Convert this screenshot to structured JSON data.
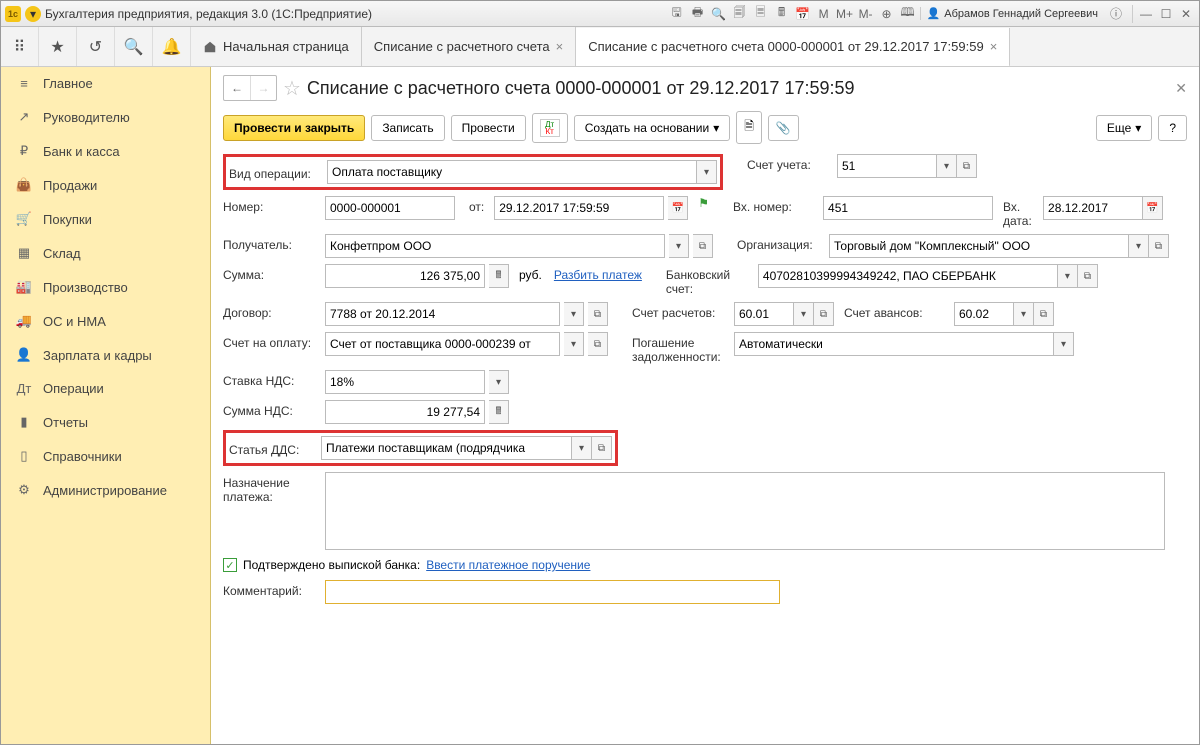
{
  "titlebar": {
    "app_title": "Бухгалтерия предприятия, редакция 3.0  (1С:Предприятие)",
    "user": "Абрамов Геннадий Сергеевич",
    "labels_M": [
      "M",
      "M+",
      "M-"
    ]
  },
  "toolbar": {
    "tabs": [
      {
        "label": "Начальная страница",
        "home": true
      },
      {
        "label": "Списание с расчетного счета",
        "closeable": true
      },
      {
        "label": "Списание с расчетного счета 0000-000001 от 29.12.2017 17:59:59",
        "closeable": true,
        "active": true
      }
    ]
  },
  "sidebar": {
    "items": [
      {
        "icon": "≡",
        "label": "Главное"
      },
      {
        "icon": "↗",
        "label": "Руководителю"
      },
      {
        "icon": "₽",
        "label": "Банк и касса"
      },
      {
        "icon": "👜",
        "label": "Продажи"
      },
      {
        "icon": "🛒",
        "label": "Покупки"
      },
      {
        "icon": "▦",
        "label": "Склад"
      },
      {
        "icon": "🏭",
        "label": "Производство"
      },
      {
        "icon": "🚚",
        "label": "ОС и НМА"
      },
      {
        "icon": "👤",
        "label": "Зарплата и кадры"
      },
      {
        "icon": "Дт",
        "label": "Операции"
      },
      {
        "icon": "▮",
        "label": "Отчеты"
      },
      {
        "icon": "▯",
        "label": "Справочники"
      },
      {
        "icon": "⚙",
        "label": "Администрирование"
      }
    ]
  },
  "doc": {
    "title": "Списание с расчетного счета 0000-000001 от 29.12.2017 17:59:59",
    "actions": {
      "post_close": "Провести и закрыть",
      "save": "Записать",
      "post": "Провести",
      "create_based": "Создать на основании",
      "more": "Еще",
      "help": "?"
    },
    "fields": {
      "op_type_lbl": "Вид операции:",
      "op_type": "Оплата поставщику",
      "acct_lbl": "Счет учета:",
      "acct": "51",
      "num_lbl": "Номер:",
      "num": "0000-000001",
      "from_lbl": "от:",
      "date": "29.12.2017 17:59:59",
      "in_num_lbl": "Вх. номер:",
      "in_num": "451",
      "in_date_lbl": "Вх. дата:",
      "in_date": "28.12.2017",
      "recipient_lbl": "Получатель:",
      "recipient": "Конфетпром ООО",
      "org_lbl": "Организация:",
      "org": "Торговый дом \"Комплексный\" ООО",
      "sum_lbl": "Сумма:",
      "sum": "126 375,00",
      "currency": "руб.",
      "split_link": "Разбить платеж",
      "bank_lbl": "Банковский счет:",
      "bank": "40702810399994349242, ПАО СБЕРБАНК",
      "contract_lbl": "Договор:",
      "contract": "7788 от 20.12.2014",
      "settle_acct_lbl": "Счет расчетов:",
      "settle_acct": "60.01",
      "advance_acct_lbl": "Счет авансов:",
      "advance_acct": "60.02",
      "pay_acct_lbl": "Счет на оплату:",
      "pay_acct": "Счет от поставщика 0000-000239 от",
      "debt_lbl": "Погашение задолженности:",
      "debt": "Автоматически",
      "vat_rate_lbl": "Ставка НДС:",
      "vat_rate": "18%",
      "vat_sum_lbl": "Сумма НДС:",
      "vat_sum": "19 277,54",
      "dds_lbl": "Статья ДДС:",
      "dds": "Платежи поставщикам (подрядчика",
      "purpose_lbl": "Назначение платежа:",
      "purpose": "",
      "confirmed_lbl": "Подтверждено выпиской банка:",
      "enter_order_link": "Ввести платежное поручение",
      "comment_lbl": "Комментарий:",
      "comment": ""
    }
  }
}
